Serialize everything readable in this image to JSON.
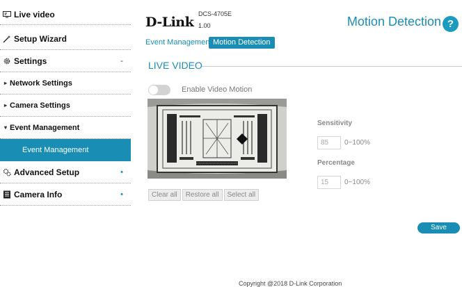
{
  "sidebar": {
    "items": [
      {
        "label": "Live video",
        "icon": "monitor-icon",
        "mark": ""
      },
      {
        "label": "Setup Wizard",
        "icon": "wand-icon",
        "mark": ""
      },
      {
        "label": "Settings",
        "icon": "gear-icon",
        "mark": "-"
      },
      {
        "label": "Network Settings",
        "icon": "bullet",
        "mark": ""
      },
      {
        "label": "Camera Settings",
        "icon": "bullet",
        "mark": ""
      },
      {
        "label": "Event Management",
        "icon": "bullet",
        "mark": ""
      },
      {
        "label": "Event Management",
        "icon": "",
        "mark": ""
      },
      {
        "label": "Advanced Setup",
        "icon": "gears-icon",
        "mark": "•"
      },
      {
        "label": "Camera Info",
        "icon": "document-icon",
        "mark": "•"
      }
    ],
    "bullet": "▸",
    "bullet_open": "▾"
  },
  "header": {
    "brand": "D-Link",
    "model": "DCS-4705E",
    "firmware": "1.00",
    "page_title": "Motion Detection",
    "help_glyph": "?"
  },
  "tabs": [
    {
      "label": "Event Management",
      "active": false
    },
    {
      "label": "Motion Detection",
      "active": true
    }
  ],
  "section": {
    "title": "LIVE VIDEO"
  },
  "motion": {
    "enable_label": "Enable Video Motion",
    "enabled": false
  },
  "buttons": {
    "clear_all": "Clear all",
    "restore_all": "Restore all",
    "select_all": "Select all",
    "save": "Save"
  },
  "sensitivity": {
    "label": "Sensitivity",
    "value": "85",
    "range": "0~100%"
  },
  "percentage": {
    "label": "Percentage",
    "value": "15",
    "range": "0~100%"
  },
  "footer": {
    "copyright": "Copyright @2018 D-Link Corporation"
  },
  "colors": {
    "accent": "#1a8db4",
    "toggle_off": "#d3d3d3"
  }
}
